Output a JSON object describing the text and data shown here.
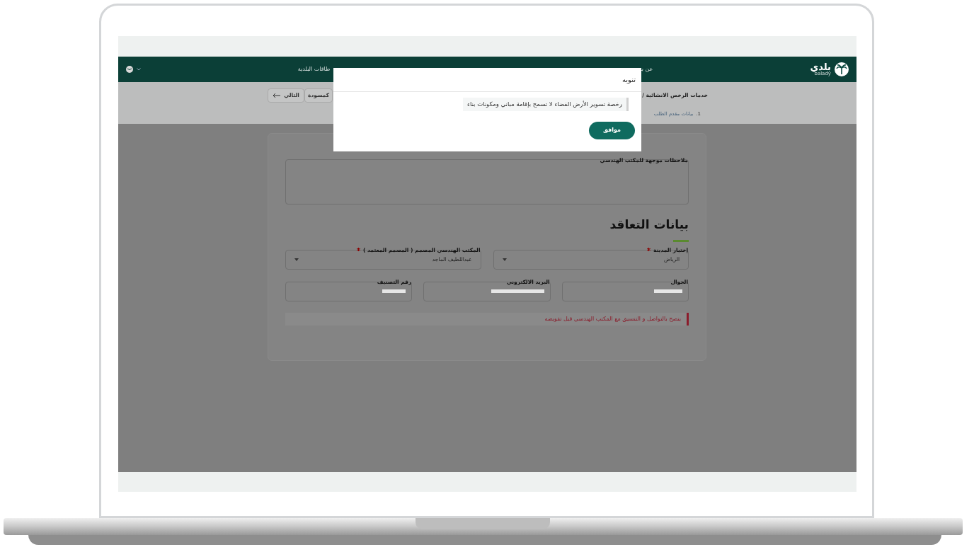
{
  "nav": {
    "logo_text": "بلدي",
    "logo_subtext": "balady",
    "items": [
      "عن بـ",
      "طاقات البلدية"
    ]
  },
  "breadcrumb": {
    "title": "خدمات الرخص الانشائية /"
  },
  "actions": [
    {
      "label": "كمسودة",
      "kind": "draft"
    },
    {
      "label": "التالي",
      "kind": "next"
    }
  ],
  "steps": [
    {
      "number": "1.",
      "label": "بيانات مقدم الطلب"
    }
  ],
  "form": {
    "notes_label": "ملاحظات موجهة للمكتب الهندسي",
    "section_title": "بيانات التعاقد",
    "selects": [
      {
        "label": "إختيار المدينة",
        "required": true,
        "value": "الرياض"
      },
      {
        "label": "المكتب الهندسي المصمم ( المصمم المعتمد )",
        "required": true,
        "value": "عبداللطيف الماجد"
      }
    ],
    "fields": [
      {
        "label": "الجوال"
      },
      {
        "label": "البريد الالكتروني"
      },
      {
        "label": "رقم التصنيف"
      }
    ],
    "alert": "ينصح بالتواصل و التنسيق مع المكتب الهندسي قبل تفويضه"
  },
  "modal": {
    "title": "تنويه",
    "message": "رخصة تسوير الأرض الفضاء لا تسمح بإقامة مباني ومكونات بناء",
    "button": "موافق"
  }
}
